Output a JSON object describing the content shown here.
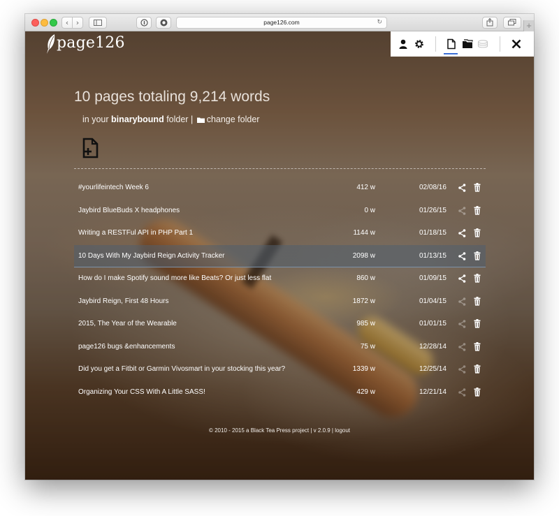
{
  "browser": {
    "url": "page126.com",
    "icons": {
      "back": "chevron-left-icon",
      "forward": "chevron-right-icon",
      "sidebar": "sidebar-icon",
      "reader": "reader-icon",
      "extension": "extension-icon",
      "reload": "reload-icon",
      "share": "share-icon",
      "tabs": "tabs-icon",
      "new_tab": "+"
    }
  },
  "app": {
    "logo_text": "page126",
    "toolbar": {
      "icons": [
        "user-icon",
        "gear-icon",
        "pages-icon",
        "folder-icon",
        "stack-icon",
        "close-icon"
      ],
      "active": "pages-icon",
      "active_color": "#3b6fd6"
    }
  },
  "summary": {
    "heading": "10 pages totaling 9,214 words",
    "folder_prefix": "in your",
    "folder_name": "binarybound",
    "folder_suffix": "folder |",
    "change_folder": "change folder"
  },
  "pages": [
    {
      "title": "#yourlifeintech Week 6",
      "words": "412 w",
      "date": "02/08/16",
      "shared": true,
      "selected": false
    },
    {
      "title": "Jaybird BlueBuds X headphones",
      "words": "0 w",
      "date": "01/26/15",
      "shared": false,
      "selected": false
    },
    {
      "title": "Writing a RESTFul API in PHP Part 1",
      "words": "1144 w",
      "date": "01/18/15",
      "shared": true,
      "selected": false
    },
    {
      "title": "10 Days With My Jaybird Reign Activity Tracker",
      "words": "2098 w",
      "date": "01/13/15",
      "shared": true,
      "selected": true
    },
    {
      "title": "How do I make Spotify sound more like Beats? Or just less flat",
      "words": "860 w",
      "date": "01/09/15",
      "shared": true,
      "selected": false
    },
    {
      "title": "Jaybird Reign, First 48 Hours",
      "words": "1872 w",
      "date": "01/04/15",
      "shared": false,
      "selected": false
    },
    {
      "title": "2015, The Year of the Wearable",
      "words": "985 w",
      "date": "01/01/15",
      "shared": false,
      "selected": false
    },
    {
      "title": "page126 bugs &enhancements",
      "words": "75 w",
      "date": "12/28/14",
      "shared": false,
      "selected": false
    },
    {
      "title": "Did you get a Fitbit or Garmin Vivosmart in your stocking this year?",
      "words": "1339 w",
      "date": "12/25/14",
      "shared": false,
      "selected": false
    },
    {
      "title": "Organizing Your CSS With A Little SASS!",
      "words": "429 w",
      "date": "12/21/14",
      "shared": false,
      "selected": false
    }
  ],
  "footer": {
    "text": "© 2010 - 2015 a Black Tea Press project | v 2.0.9 |",
    "logout": "logout"
  }
}
